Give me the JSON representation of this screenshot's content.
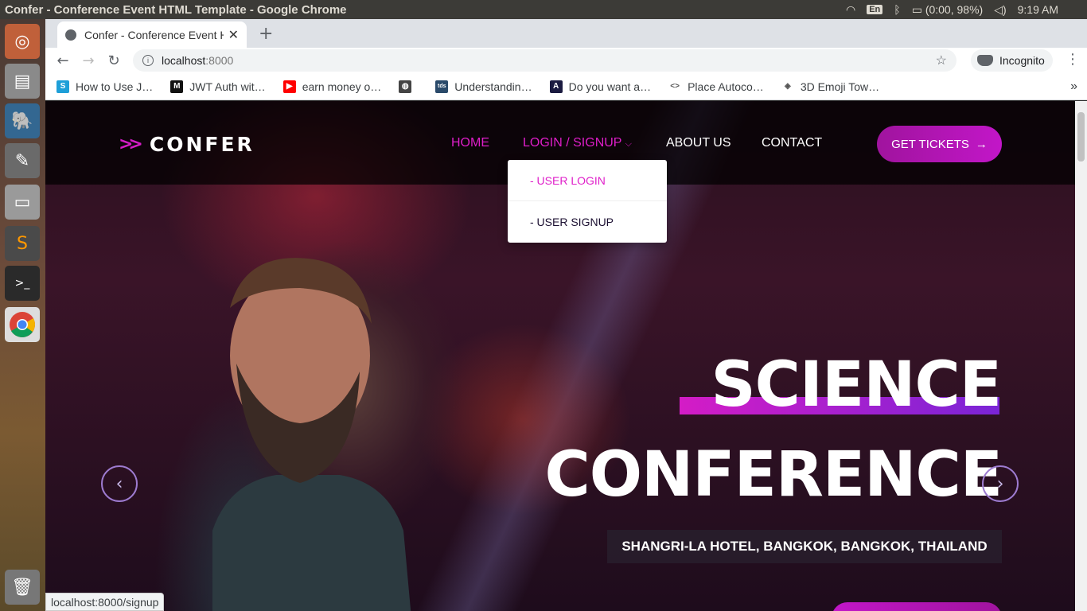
{
  "os": {
    "window_title": "Confer - Conference Event HTML Template - Google Chrome",
    "keyboard": "En",
    "battery": "(0:00, 98%)",
    "clock": "9:19 AM"
  },
  "browser": {
    "tab_title": "Confer - Conference Event HTML Template",
    "url_host": "localhost",
    "url_port": ":8000",
    "profile": "Incognito",
    "bookmarks": [
      {
        "label": "How to Use J…",
        "color": "#1e9fd8",
        "glyph": "S"
      },
      {
        "label": "JWT Auth wit…",
        "color": "#111111",
        "glyph": "M"
      },
      {
        "label": "earn money o…",
        "color": "#ff0000",
        "glyph": "▶"
      },
      {
        "label": "",
        "color": "#444444",
        "glyph": "◍"
      },
      {
        "label": "Understandin…",
        "color": "#2a4a6a",
        "glyph": "tds"
      },
      {
        "label": "Do you want a…",
        "color": "#1a1a40",
        "glyph": "A"
      },
      {
        "label": "Place Autoco…",
        "color": "#ffffff",
        "glyph": "<>"
      },
      {
        "label": "3D Emoji Tow…",
        "color": "#ffffff",
        "glyph": "◈"
      }
    ],
    "status_url": "localhost:8000/signup"
  },
  "site": {
    "logo": "CONFER",
    "nav": {
      "home": "HOME",
      "login_signup": "LOGIN / SIGNUP",
      "about": "ABOUT US",
      "contact": "CONTACT"
    },
    "tickets_button": "GET TICKETS",
    "dropdown": {
      "user_login": "- USER LOGIN",
      "user_signup": "- USER SIGNUP"
    },
    "hero": {
      "title_line1": "SCIENCE",
      "title_line2": "CONFERENCE",
      "venue": "SHANGRI-LA HOTEL, BANGKOK, BANGKOK, THAILAND"
    },
    "colors": {
      "accent": "#df1ec9",
      "accent_purple": "#7a24d6"
    }
  }
}
